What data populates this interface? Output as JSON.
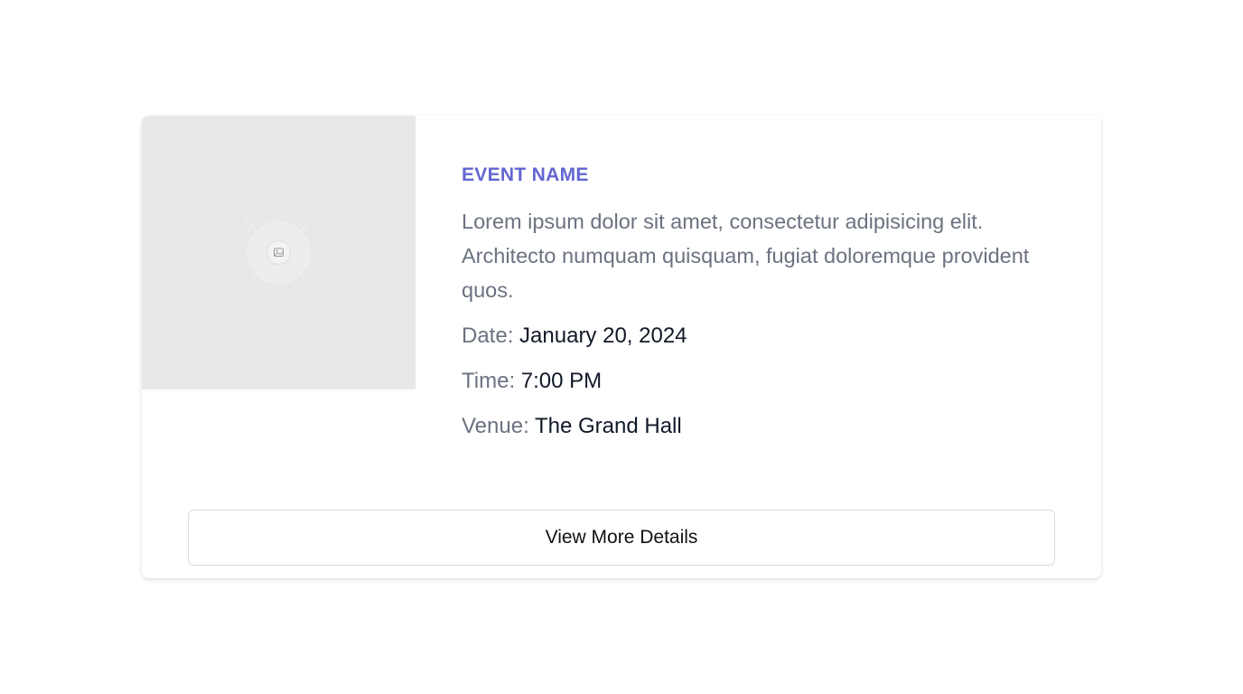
{
  "event": {
    "name": "EVENT NAME",
    "description": "Lorem ipsum dolor sit amet, consectetur adipisicing elit. Architecto numquam quisquam, fugiat doloremque provident quos.",
    "date_label": "Date:",
    "date_value": "January 20, 2024",
    "time_label": "Time:",
    "time_value": "7:00 PM",
    "venue_label": "Venue:",
    "venue_value": "The Grand Hall"
  },
  "image": {
    "icon": "image-icon"
  },
  "actions": {
    "view_more_label": "View More Details"
  },
  "colors": {
    "accent": "#6366d1",
    "muted_text": "#6b7280",
    "primary_text": "#111827",
    "placeholder_bg": "#e8e8e8",
    "border": "#d9dbe0"
  }
}
